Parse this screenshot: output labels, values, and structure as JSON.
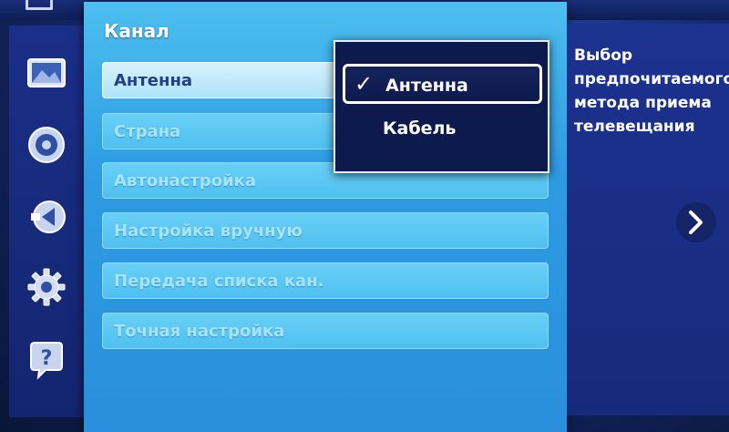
{
  "panel": {
    "title": "Канал"
  },
  "menu": {
    "items": [
      {
        "label": "Антенна",
        "selected": true
      },
      {
        "label": "Страна",
        "selected": false
      },
      {
        "label": "Автонастройка",
        "selected": false
      },
      {
        "label": "Настройка вручную",
        "selected": false
      },
      {
        "label": "Передача списка кан.",
        "selected": false
      },
      {
        "label": "Точная настройка",
        "selected": false
      }
    ]
  },
  "dropdown": {
    "options": [
      {
        "label": "Антенна",
        "checked": true,
        "check_mark": "✓"
      },
      {
        "label": "Кабель",
        "checked": false
      }
    ]
  },
  "help": {
    "text": "Выбор\nпредпочитаемого\nметода приема\nтелевещания"
  },
  "sidebar": {
    "icons": [
      "picture-icon",
      "sound-icon",
      "broadcast-icon",
      "settings-gear-icon",
      "help-question-icon"
    ]
  },
  "colors": {
    "panel_accent": "#2e9be3",
    "dropdown_bg": "#0d1a4d",
    "rail_bg": "#1a2f88"
  }
}
